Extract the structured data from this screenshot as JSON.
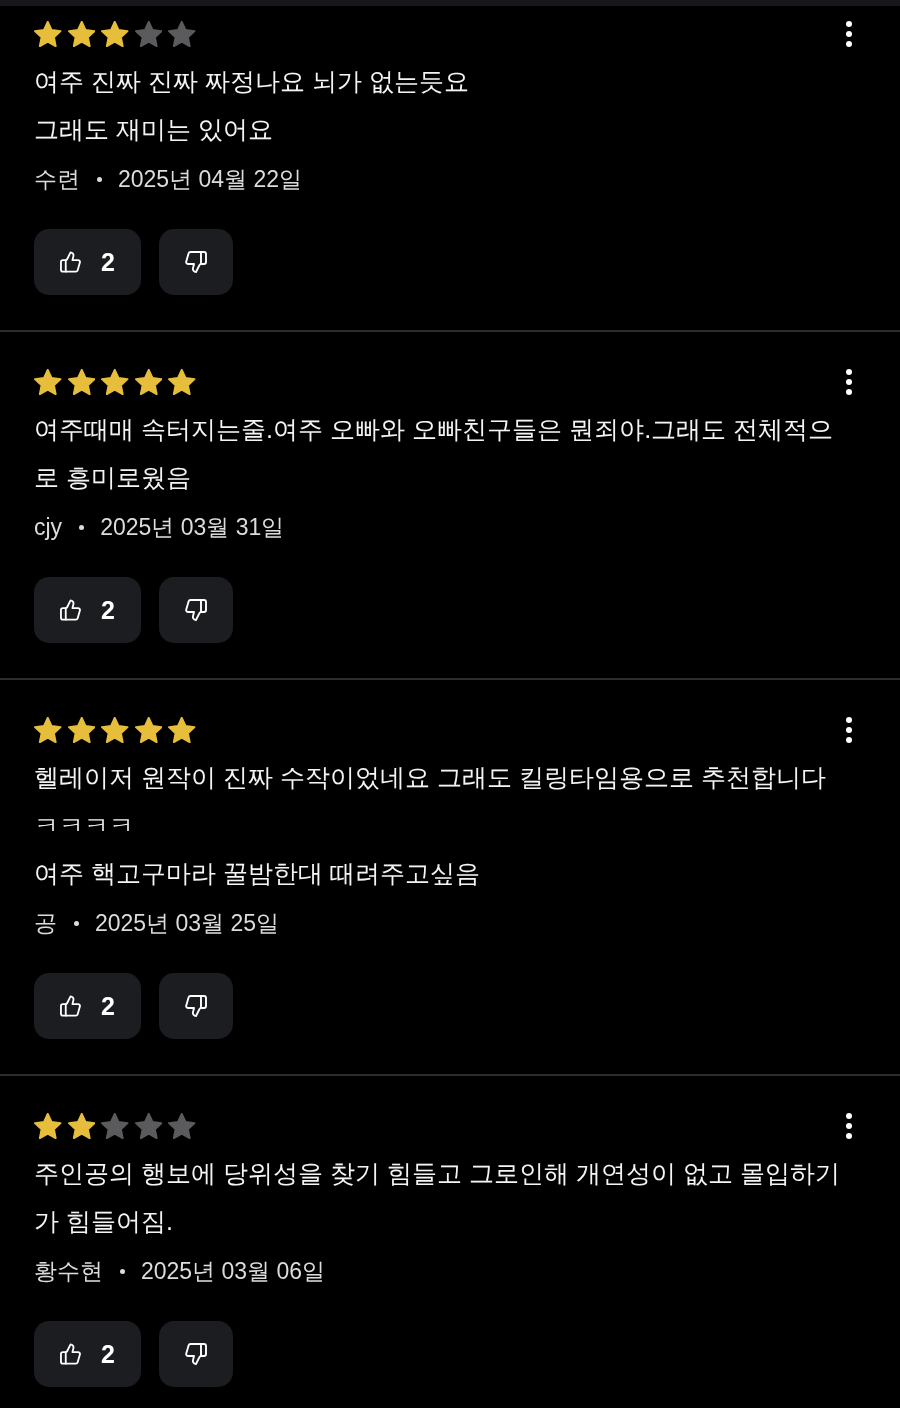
{
  "reviews": [
    {
      "stars": 3,
      "text": "여주 진짜 진짜 짜정나요 뇌가 없는듯요\n그래도 재미는 있어요",
      "author": "수련",
      "date": "2025년 04월 22일",
      "likes": "2"
    },
    {
      "stars": 5,
      "text": "여주때매 속터지는줄.여주 오빠와 오빠친구들은 뭔죄야.그래도 전체적으로 흥미로웠음",
      "author": "cjy",
      "date": "2025년 03월 31일",
      "likes": "2"
    },
    {
      "stars": 5,
      "text": "헬레이저 원작이 진짜 수작이었네요 그래도 킬링타임용으로 추천합니다\nㅋㅋㅋㅋ\n여주 핵고구마라 꿀밤한대 때려주고싶음",
      "author": "공",
      "date": "2025년 03월 25일",
      "likes": "2"
    },
    {
      "stars": 2,
      "text": "주인공의 행보에 당위성을 찾기 힘들고 그로인해 개연성이 없고 몰입하기가 힘들어짐.",
      "author": "황수현",
      "date": "2025년 03월 06일",
      "likes": "2"
    }
  ]
}
